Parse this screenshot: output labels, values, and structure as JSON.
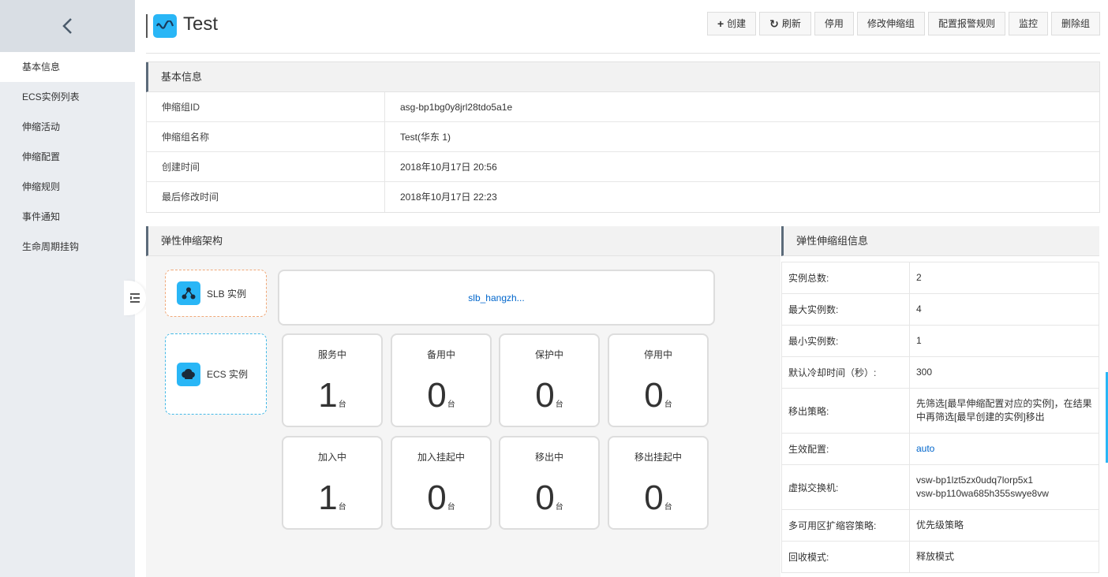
{
  "sidebar": {
    "items": [
      {
        "label": "基本信息",
        "active": true
      },
      {
        "label": "ECS实例列表"
      },
      {
        "label": "伸缩活动"
      },
      {
        "label": "伸缩配置"
      },
      {
        "label": "伸缩规则"
      },
      {
        "label": "事件通知"
      },
      {
        "label": "生命周期挂钩"
      }
    ]
  },
  "header": {
    "title": "Test",
    "buttons": {
      "create": "创建",
      "refresh": "刷新",
      "disable": "停用",
      "modify": "修改伸缩组",
      "alarm": "配置报警规则",
      "monitor": "监控",
      "delete": "删除组"
    }
  },
  "basic": {
    "heading": "基本信息",
    "rows": [
      {
        "label": "伸缩组ID",
        "value": "asg-bp1bg0y8jrl28tdo5a1e"
      },
      {
        "label": "伸缩组名称",
        "value": "Test(华东 1)"
      },
      {
        "label": "创建时间",
        "value": "2018年10月17日 20:56"
      },
      {
        "label": "最后修改时间",
        "value": "2018年10月17日 22:23"
      }
    ]
  },
  "arch": {
    "heading": "弹性伸缩架构",
    "slb_label": "SLB 实例",
    "ecs_label": "ECS 实例",
    "slb_link": "slb_hangzh...",
    "unit": "台",
    "stats": [
      {
        "label": "服务中",
        "value": "1"
      },
      {
        "label": "备用中",
        "value": "0"
      },
      {
        "label": "保护中",
        "value": "0"
      },
      {
        "label": "停用中",
        "value": "0"
      },
      {
        "label": "加入中",
        "value": "1"
      },
      {
        "label": "加入挂起中",
        "value": "0"
      },
      {
        "label": "移出中",
        "value": "0"
      },
      {
        "label": "移出挂起中",
        "value": "0"
      }
    ]
  },
  "group_info": {
    "heading": "弹性伸缩组信息",
    "rows": [
      {
        "label": "实例总数:",
        "value": "2"
      },
      {
        "label": "最大实例数:",
        "value": "4"
      },
      {
        "label": "最小实例数:",
        "value": "1"
      },
      {
        "label": "默认冷却时间（秒）:",
        "value": "300"
      },
      {
        "label": "移出策略:",
        "value": "先筛选[最早伸缩配置对应的实例]，在结果中再筛选[最早创建的实例]移出"
      },
      {
        "label": "生效配置:",
        "value": "auto"
      },
      {
        "label": "虚拟交换机:",
        "value": "vsw-bp1lzt5zx0udq7lorp5x1",
        "value2": "vsw-bp110wa685h355swye8vw"
      },
      {
        "label": "多可用区扩缩容策略:",
        "value": "优先级策略"
      },
      {
        "label": "回收模式:",
        "value": "释放模式"
      }
    ]
  }
}
